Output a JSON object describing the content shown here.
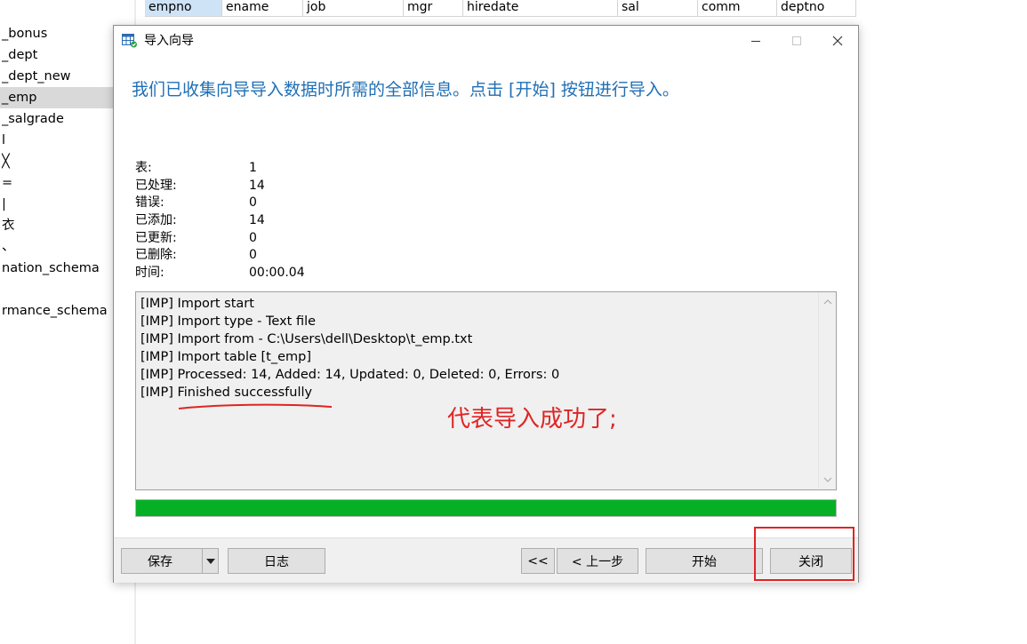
{
  "sidebar": {
    "items": [
      "_bonus",
      "_dept",
      "_dept_new",
      "_emp",
      "_salgrade",
      "l",
      "╳",
      "=",
      "|",
      "衣",
      "、",
      "nation_schema",
      "rmance_schema"
    ]
  },
  "grid": {
    "columns": [
      "empno",
      "ename",
      "job",
      "mgr",
      "hiredate",
      "sal",
      "comm",
      "deptno"
    ]
  },
  "dialog": {
    "title": "导入向导",
    "headline": "我们已收集向导导入数据时所需的全部信息。点击 [开始] 按钮进行导入。",
    "stats": [
      {
        "label": "表:",
        "value": "1"
      },
      {
        "label": "已处理:",
        "value": "14"
      },
      {
        "label": "错误:",
        "value": "0"
      },
      {
        "label": "已添加:",
        "value": "14"
      },
      {
        "label": "已更新:",
        "value": "0"
      },
      {
        "label": "已删除:",
        "value": "0"
      },
      {
        "label": "时间:",
        "value": "00:00.04"
      }
    ],
    "log": [
      "[IMP] Import start",
      "[IMP] Import type - Text file",
      "[IMP] Import from - C:\\Users\\dell\\Desktop\\t_emp.txt",
      "[IMP] Import table [t_emp]",
      "[IMP] Processed: 14, Added: 14, Updated: 0, Deleted: 0, Errors: 0",
      "[IMP] Finished successfully"
    ],
    "annotation": "代表导入成功了;",
    "progress_percent": 100,
    "buttons": {
      "save": "保存",
      "log": "日志",
      "first": "<<",
      "prev": "< 上一步",
      "start": "开始",
      "close": "关闭"
    }
  },
  "colors": {
    "headline": "#1f6fb5",
    "progress": "#06b025",
    "annotation": "#e02424"
  }
}
